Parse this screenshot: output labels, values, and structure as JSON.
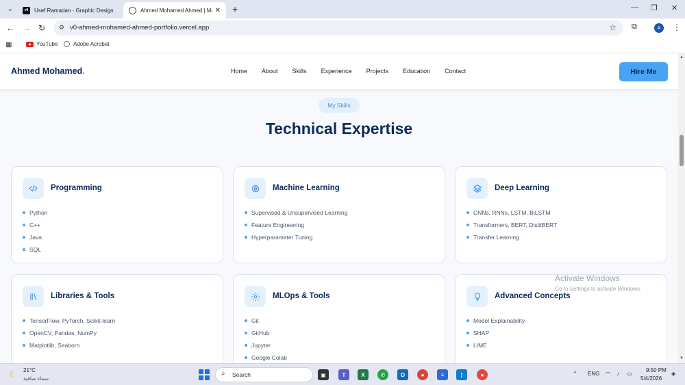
{
  "browser": {
    "tabs": [
      {
        "title": "Usef Ramadan - Graphic Design"
      },
      {
        "title": "Ahmed Mohamed Ahmed | Ma"
      }
    ],
    "url": "v0-ahmed-mohamed-ahmed-portfolio.vercel.app",
    "profile_initial": "A",
    "bookmarks": [
      "YouTube",
      "Adobe Acrobat"
    ]
  },
  "site": {
    "logo": "Ahmed Mohamed",
    "logo_dot": ".",
    "nav": [
      "Home",
      "About",
      "Skills",
      "Experience",
      "Projects",
      "Education",
      "Contact"
    ],
    "hire_button": "Hire Me"
  },
  "skills": {
    "pill": "My Skills",
    "title": "Technical Expertise",
    "cards": [
      {
        "icon": "code-icon",
        "title": "Programming",
        "items": [
          "Python",
          "C++",
          "Java",
          "SQL"
        ]
      },
      {
        "icon": "brain-icon",
        "title": "Machine Learning",
        "items": [
          "Supervised & Unsupervised Learning",
          "Feature Engineering",
          "Hyperparameter Tuning"
        ]
      },
      {
        "icon": "layers-icon",
        "title": "Deep Learning",
        "items": [
          "CNNs, RNNs, LSTM, BiLSTM",
          "Transformers, BERT, DistilBERT",
          "Transfer Learning"
        ]
      },
      {
        "icon": "library-icon",
        "title": "Libraries & Tools",
        "items": [
          "TensorFlow, PyTorch, Scikit-learn",
          "OpenCV, Pandas, NumPy",
          "Matplotlib, Seaborn"
        ]
      },
      {
        "icon": "gear-icon",
        "title": "MLOps & Tools",
        "items": [
          "Git",
          "GitHub",
          "Jupyter",
          "Google Colab"
        ]
      },
      {
        "icon": "lightbulb-icon",
        "title": "Advanced Concepts",
        "items": [
          "Model Explainability",
          "SHAP",
          "LIME"
        ]
      }
    ]
  },
  "watermark": {
    "title": "Activate Windows",
    "subtitle": "Go to Settings to activate Windows."
  },
  "taskbar": {
    "temperature": "21°C",
    "weather_desc": "سماء صافية",
    "search_placeholder": "Search",
    "language": "ENG",
    "time": "9:50 PM",
    "date": "5/4/2026"
  }
}
